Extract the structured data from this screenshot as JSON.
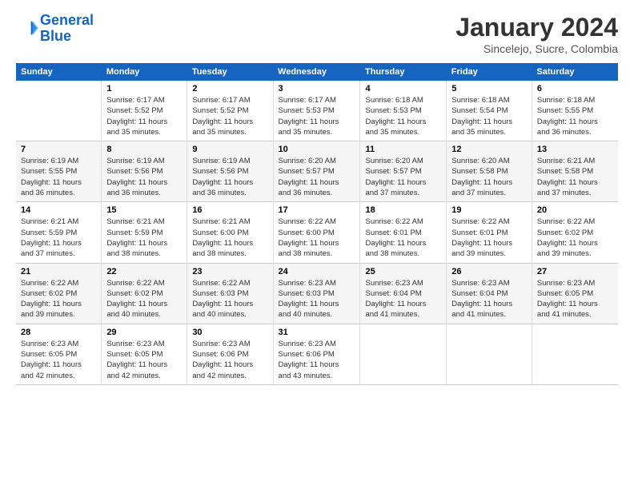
{
  "logo": {
    "line1": "General",
    "line2": "Blue"
  },
  "title": "January 2024",
  "subtitle": "Sincelejo, Sucre, Colombia",
  "days_of_week": [
    "Sunday",
    "Monday",
    "Tuesday",
    "Wednesday",
    "Thursday",
    "Friday",
    "Saturday"
  ],
  "weeks": [
    [
      {
        "num": "",
        "info": ""
      },
      {
        "num": "1",
        "info": "Sunrise: 6:17 AM\nSunset: 5:52 PM\nDaylight: 11 hours\nand 35 minutes."
      },
      {
        "num": "2",
        "info": "Sunrise: 6:17 AM\nSunset: 5:52 PM\nDaylight: 11 hours\nand 35 minutes."
      },
      {
        "num": "3",
        "info": "Sunrise: 6:17 AM\nSunset: 5:53 PM\nDaylight: 11 hours\nand 35 minutes."
      },
      {
        "num": "4",
        "info": "Sunrise: 6:18 AM\nSunset: 5:53 PM\nDaylight: 11 hours\nand 35 minutes."
      },
      {
        "num": "5",
        "info": "Sunrise: 6:18 AM\nSunset: 5:54 PM\nDaylight: 11 hours\nand 35 minutes."
      },
      {
        "num": "6",
        "info": "Sunrise: 6:18 AM\nSunset: 5:55 PM\nDaylight: 11 hours\nand 36 minutes."
      }
    ],
    [
      {
        "num": "7",
        "info": "Sunrise: 6:19 AM\nSunset: 5:55 PM\nDaylight: 11 hours\nand 36 minutes."
      },
      {
        "num": "8",
        "info": "Sunrise: 6:19 AM\nSunset: 5:56 PM\nDaylight: 11 hours\nand 36 minutes."
      },
      {
        "num": "9",
        "info": "Sunrise: 6:19 AM\nSunset: 5:56 PM\nDaylight: 11 hours\nand 36 minutes."
      },
      {
        "num": "10",
        "info": "Sunrise: 6:20 AM\nSunset: 5:57 PM\nDaylight: 11 hours\nand 36 minutes."
      },
      {
        "num": "11",
        "info": "Sunrise: 6:20 AM\nSunset: 5:57 PM\nDaylight: 11 hours\nand 37 minutes."
      },
      {
        "num": "12",
        "info": "Sunrise: 6:20 AM\nSunset: 5:58 PM\nDaylight: 11 hours\nand 37 minutes."
      },
      {
        "num": "13",
        "info": "Sunrise: 6:21 AM\nSunset: 5:58 PM\nDaylight: 11 hours\nand 37 minutes."
      }
    ],
    [
      {
        "num": "14",
        "info": "Sunrise: 6:21 AM\nSunset: 5:59 PM\nDaylight: 11 hours\nand 37 minutes."
      },
      {
        "num": "15",
        "info": "Sunrise: 6:21 AM\nSunset: 5:59 PM\nDaylight: 11 hours\nand 38 minutes."
      },
      {
        "num": "16",
        "info": "Sunrise: 6:21 AM\nSunset: 6:00 PM\nDaylight: 11 hours\nand 38 minutes."
      },
      {
        "num": "17",
        "info": "Sunrise: 6:22 AM\nSunset: 6:00 PM\nDaylight: 11 hours\nand 38 minutes."
      },
      {
        "num": "18",
        "info": "Sunrise: 6:22 AM\nSunset: 6:01 PM\nDaylight: 11 hours\nand 38 minutes."
      },
      {
        "num": "19",
        "info": "Sunrise: 6:22 AM\nSunset: 6:01 PM\nDaylight: 11 hours\nand 39 minutes."
      },
      {
        "num": "20",
        "info": "Sunrise: 6:22 AM\nSunset: 6:02 PM\nDaylight: 11 hours\nand 39 minutes."
      }
    ],
    [
      {
        "num": "21",
        "info": "Sunrise: 6:22 AM\nSunset: 6:02 PM\nDaylight: 11 hours\nand 39 minutes."
      },
      {
        "num": "22",
        "info": "Sunrise: 6:22 AM\nSunset: 6:02 PM\nDaylight: 11 hours\nand 40 minutes."
      },
      {
        "num": "23",
        "info": "Sunrise: 6:22 AM\nSunset: 6:03 PM\nDaylight: 11 hours\nand 40 minutes."
      },
      {
        "num": "24",
        "info": "Sunrise: 6:23 AM\nSunset: 6:03 PM\nDaylight: 11 hours\nand 40 minutes."
      },
      {
        "num": "25",
        "info": "Sunrise: 6:23 AM\nSunset: 6:04 PM\nDaylight: 11 hours\nand 41 minutes."
      },
      {
        "num": "26",
        "info": "Sunrise: 6:23 AM\nSunset: 6:04 PM\nDaylight: 11 hours\nand 41 minutes."
      },
      {
        "num": "27",
        "info": "Sunrise: 6:23 AM\nSunset: 6:05 PM\nDaylight: 11 hours\nand 41 minutes."
      }
    ],
    [
      {
        "num": "28",
        "info": "Sunrise: 6:23 AM\nSunset: 6:05 PM\nDaylight: 11 hours\nand 42 minutes."
      },
      {
        "num": "29",
        "info": "Sunrise: 6:23 AM\nSunset: 6:05 PM\nDaylight: 11 hours\nand 42 minutes."
      },
      {
        "num": "30",
        "info": "Sunrise: 6:23 AM\nSunset: 6:06 PM\nDaylight: 11 hours\nand 42 minutes."
      },
      {
        "num": "31",
        "info": "Sunrise: 6:23 AM\nSunset: 6:06 PM\nDaylight: 11 hours\nand 43 minutes."
      },
      {
        "num": "",
        "info": ""
      },
      {
        "num": "",
        "info": ""
      },
      {
        "num": "",
        "info": ""
      }
    ]
  ]
}
